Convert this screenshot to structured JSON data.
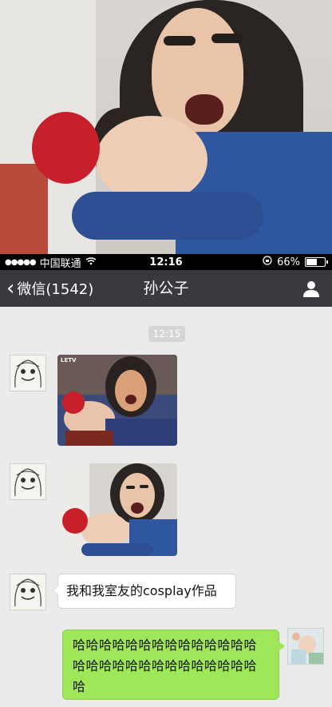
{
  "status_bar": {
    "carrier": "中国联通",
    "time": "12:16",
    "battery": "66%",
    "battery_level": 0.66
  },
  "nav": {
    "back_label": "微信(1542)",
    "title": "孙公子"
  },
  "chat": {
    "timestamp": "12:15",
    "messages": [
      {
        "side": "left",
        "type": "image",
        "image_caption": "LETV"
      },
      {
        "side": "left",
        "type": "image"
      },
      {
        "side": "left",
        "type": "text",
        "text": "我和我室友的cosplay作品"
      },
      {
        "side": "right",
        "type": "text",
        "text": "哈哈哈哈哈哈哈哈哈哈哈哈哈哈哈哈哈哈哈哈哈哈哈哈哈哈哈哈哈"
      }
    ]
  },
  "colors": {
    "nav_bg": "#393a3f",
    "chat_bg": "#ebebeb",
    "sent_bubble": "#9fe658",
    "received_bubble": "#ffffff"
  }
}
